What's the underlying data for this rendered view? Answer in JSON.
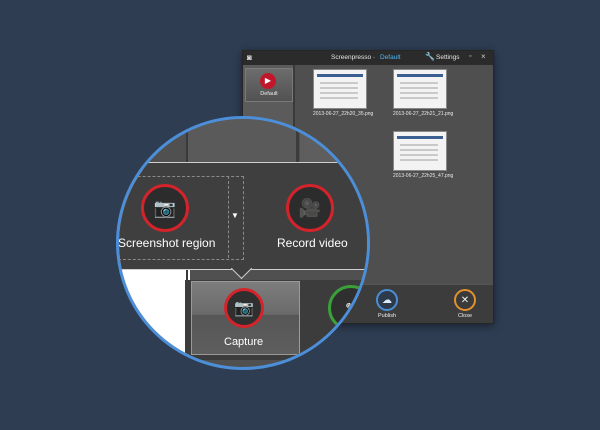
{
  "window": {
    "app_icon": "camera-icon",
    "title": "Screenpresso",
    "separator": "-",
    "profile": "Default",
    "settings_icon": "wrench-icon",
    "settings_label": "Settings",
    "minimize_symbol": "▫",
    "close_symbol": "×"
  },
  "profile_card": {
    "label": "Default",
    "logo_symbol": "▶"
  },
  "thumbnails": [
    {
      "name": "2013-06-27_22h20_35.png"
    },
    {
      "name": "2013-06-27_22h21_21.png"
    },
    {
      "name": "2013-06-27_22h25_47.png"
    }
  ],
  "bottom_bar": {
    "publish": {
      "label": "Publish",
      "icon": "cloud-upload-icon",
      "symbol": "☁"
    },
    "close": {
      "label": "Close",
      "icon": "close-icon",
      "symbol": "✕"
    }
  },
  "magnifier": {
    "screenshot_region": {
      "label": "Screenshot region",
      "icon": "camera-icon",
      "symbol": "📷"
    },
    "dropdown_symbol": "▼",
    "record_video": {
      "label": "Record video",
      "icon": "video-camera-icon",
      "symbol": "🎥"
    },
    "capture": {
      "label": "Capture",
      "icon": "camera-icon",
      "symbol": "📷"
    },
    "edit_symbol": "✎"
  },
  "colors": {
    "background": "#2e3d52",
    "accent_blue": "#4c8fd8",
    "record_red": "#d3232b",
    "profile_link": "#4fb6f0",
    "close_orange": "#e2912f",
    "edit_green": "#3aa03a"
  }
}
